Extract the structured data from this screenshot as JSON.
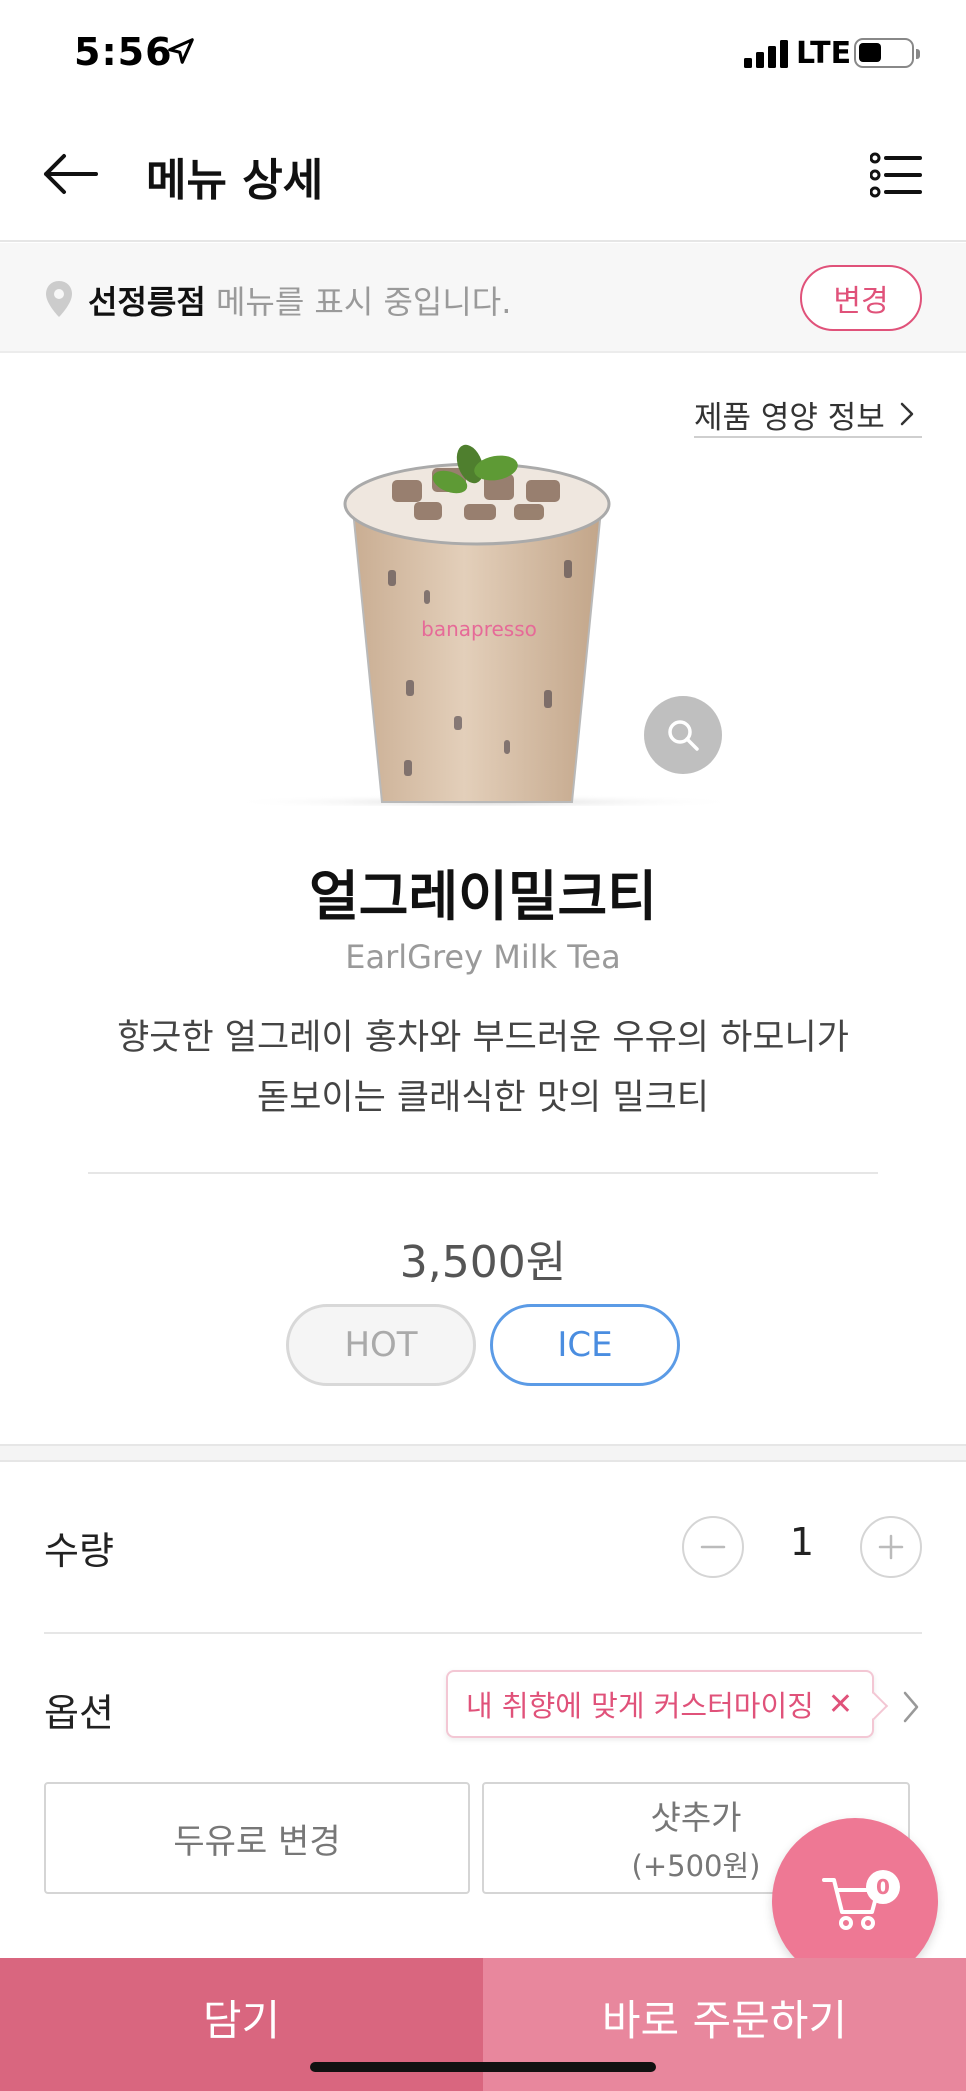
{
  "status_bar": {
    "time": "5:56",
    "network": "LTE"
  },
  "header": {
    "title": "메뉴 상세"
  },
  "store": {
    "name": "선정릉점",
    "message": " 메뉴를 표시 중입니다.",
    "change_label": "변경"
  },
  "nutrition_link": "제품 영양 정보",
  "product": {
    "image_brand": "banapresso",
    "name": "얼그레이밀크티",
    "name_en": "EarlGrey Milk Tea",
    "description_line1": "향긋한 얼그레이 홍차와 부드러운 우유의 하모니가",
    "description_line2": "돋보이는 클래식한 맛의 밀크티",
    "price": "3,500원"
  },
  "temperature": {
    "hot": "HOT",
    "ice": "ICE",
    "selected": "ICE"
  },
  "quantity": {
    "label": "수량",
    "value": "1"
  },
  "options": {
    "label": "옵션",
    "tooltip": "내 취향에 맞게 커스터마이징",
    "tooltip_close": "✕",
    "items": [
      {
        "label": "두유로 변경"
      },
      {
        "label": "샷추가",
        "sub": "(+500원)"
      }
    ]
  },
  "cart": {
    "count": "0"
  },
  "bottom": {
    "add_label": "담기",
    "order_label": "바로 주문하기"
  },
  "colors": {
    "accent": "#e0527a",
    "ice": "#4a8de0",
    "cart": "#ee7894",
    "add": "#d9667f",
    "order": "#e8879d"
  }
}
